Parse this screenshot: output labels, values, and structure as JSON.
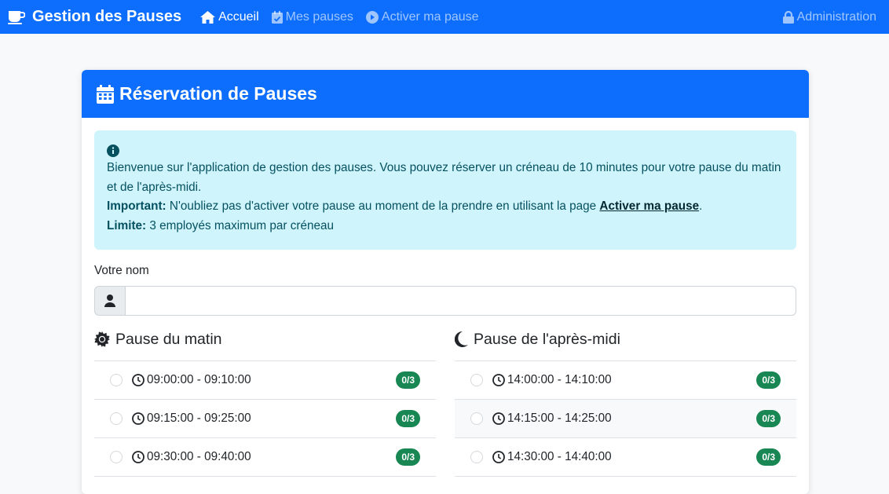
{
  "navbar": {
    "brand": "Gestion des Pauses",
    "links": [
      {
        "label": "Accueil",
        "icon": "home-icon",
        "active": true
      },
      {
        "label": "Mes pauses",
        "icon": "calendar-check-icon",
        "active": false
      },
      {
        "label": "Activer ma pause",
        "icon": "play-circle-icon",
        "active": false
      }
    ],
    "admin": "Administration"
  },
  "card": {
    "title": "Réservation de Pauses"
  },
  "alert": {
    "intro": "Bienvenue sur l'application de gestion des pauses. Vous pouvez réserver un créneau de 10 minutes pour votre pause du matin et de l'après-midi.",
    "important_label": "Important:",
    "important_text_before": " N'oubliez pas d'activer votre pause au moment de la prendre en utilisant la page ",
    "important_link": "Activer ma pause",
    "important_text_after": ".",
    "limit_label": "Limite:",
    "limit_text": " 3 employés maximum par créneau"
  },
  "form": {
    "name_label": "Votre nom",
    "name_value": "",
    "name_placeholder": ""
  },
  "morning": {
    "title": "Pause du matin",
    "slots": [
      {
        "time": "09:00:00 - 09:10:00",
        "count": "0/3"
      },
      {
        "time": "09:15:00 - 09:25:00",
        "count": "0/3"
      },
      {
        "time": "09:30:00 - 09:40:00",
        "count": "0/3"
      }
    ]
  },
  "afternoon": {
    "title": "Pause de l'après-midi",
    "slots": [
      {
        "time": "14:00:00 - 14:10:00",
        "count": "0/3"
      },
      {
        "time": "14:15:00 - 14:25:00",
        "count": "0/3"
      },
      {
        "time": "14:30:00 - 14:40:00",
        "count": "0/3"
      }
    ]
  },
  "colors": {
    "primary": "#0d6efd",
    "info_bg": "#cff4fc",
    "badge_success": "#198754"
  }
}
